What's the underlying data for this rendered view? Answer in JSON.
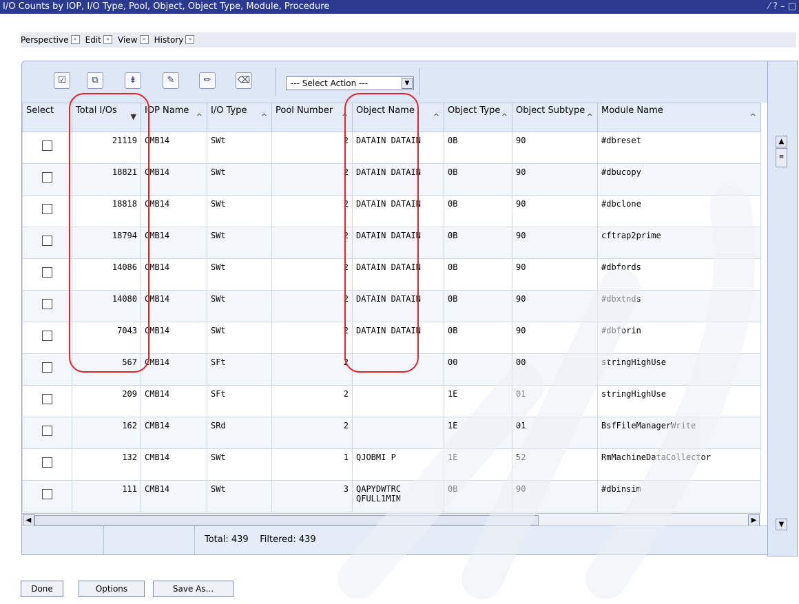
{
  "window": {
    "title": "I/O Counts by IOP, I/O Type, Pool, Object, Object Type, Module, Procedure",
    "controls": "⁄ ? – □"
  },
  "menubar": {
    "items": [
      {
        "label": "Perspective"
      },
      {
        "label": "Edit"
      },
      {
        "label": "View"
      },
      {
        "label": "History"
      }
    ]
  },
  "toolbar": {
    "action_select": "--- Select Action ---"
  },
  "table": {
    "columns": [
      {
        "label": "Select"
      },
      {
        "label": "Total I/Os",
        "sort": "▼"
      },
      {
        "label": "IOP Name",
        "sort": "^"
      },
      {
        "label": "I/O Type",
        "sort": "^"
      },
      {
        "label": "Pool Number",
        "sort": "^"
      },
      {
        "label": "Object Name",
        "sort": "^"
      },
      {
        "label": "Object Type",
        "sort": "^"
      },
      {
        "label": "Object Subtype",
        "sort": "^"
      },
      {
        "label": "Module Name",
        "sort": "^"
      }
    ],
    "rows": [
      {
        "total": "21119",
        "iop": "CMB14",
        "iotype": "SWt",
        "pool": "2",
        "objname": "DATAIN DATAIN",
        "objtype": "0B",
        "subtype": "90",
        "module": "#dbreset"
      },
      {
        "total": "18821",
        "iop": "CMB14",
        "iotype": "SWt",
        "pool": "2",
        "objname": "DATAIN DATAIN",
        "objtype": "0B",
        "subtype": "90",
        "module": "#dbucopy"
      },
      {
        "total": "18818",
        "iop": "CMB14",
        "iotype": "SWt",
        "pool": "2",
        "objname": "DATAIN DATAIN",
        "objtype": "0B",
        "subtype": "90",
        "module": "#dbclone"
      },
      {
        "total": "18794",
        "iop": "CMB14",
        "iotype": "SWt",
        "pool": "2",
        "objname": "DATAIN DATAIN",
        "objtype": "0B",
        "subtype": "90",
        "module": "cftrap2prime"
      },
      {
        "total": "14086",
        "iop": "CMB14",
        "iotype": "SWt",
        "pool": "2",
        "objname": "DATAIN DATAIN",
        "objtype": "0B",
        "subtype": "90",
        "module": "#dbfords"
      },
      {
        "total": "14080",
        "iop": "CMB14",
        "iotype": "SWt",
        "pool": "2",
        "objname": "DATAIN DATAIN",
        "objtype": "0B",
        "subtype": "90",
        "module": "#dbxtnds"
      },
      {
        "total": "7043",
        "iop": "CMB14",
        "iotype": "SWt",
        "pool": "2",
        "objname": "DATAIN DATAIN",
        "objtype": "0B",
        "subtype": "90",
        "module": "#dbforin"
      },
      {
        "total": "567",
        "iop": "CMB14",
        "iotype": "SFt",
        "pool": "2",
        "objname": "",
        "objtype": "00",
        "subtype": "00",
        "module": "stringHighUse"
      },
      {
        "total": "209",
        "iop": "CMB14",
        "iotype": "SFt",
        "pool": "2",
        "objname": "",
        "objtype": "1E",
        "subtype": "01",
        "module": "stringHighUse"
      },
      {
        "total": "162",
        "iop": "CMB14",
        "iotype": "SRd",
        "pool": "2",
        "objname": "",
        "objtype": "1E",
        "subtype": "01",
        "module": "BsfFileManagerWrite"
      },
      {
        "total": "132",
        "iop": "CMB14",
        "iotype": "SWt",
        "pool": "1",
        "objname": "QJOBMI P",
        "objtype": "1E",
        "subtype": "52",
        "module": "RmMachineDataCollector"
      },
      {
        "total": "111",
        "iop": "CMB14",
        "iotype": "SWt",
        "pool": "3",
        "objname": "QAPYDWTRC QFULL1MIN",
        "objtype": "0B",
        "subtype": "90",
        "module": "#dbinsim"
      }
    ]
  },
  "footer": {
    "total_text": "Total: 439    Filtered: 439"
  },
  "buttons": {
    "done": "Done",
    "options": "Options",
    "save_as": "Save As..."
  }
}
